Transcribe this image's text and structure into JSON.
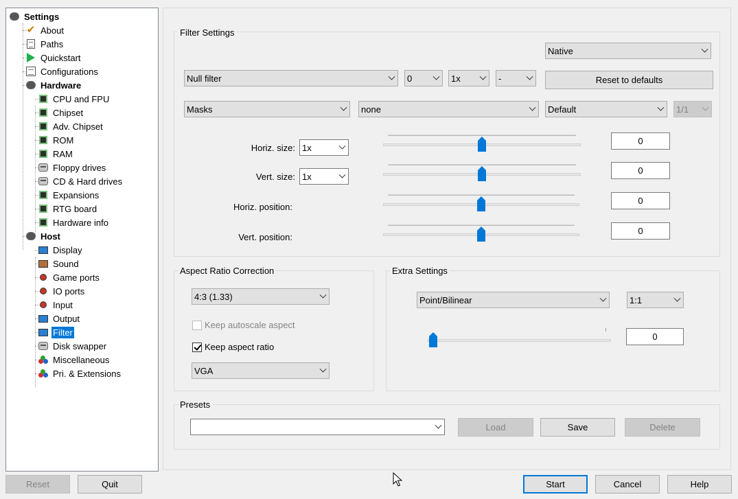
{
  "tree": {
    "items": [
      {
        "label": "Settings",
        "icon": "settings-disk-icon",
        "level": 0,
        "bold": true
      },
      {
        "label": "About",
        "icon": "checkmark-icon",
        "level": 1
      },
      {
        "label": "Paths",
        "icon": "document-icon",
        "level": 1
      },
      {
        "label": "Quickstart",
        "icon": "play-arrow-icon",
        "level": 1
      },
      {
        "label": "Configurations",
        "icon": "configurations-icon",
        "level": 1
      },
      {
        "label": "Hardware",
        "icon": "hardware-disk-icon",
        "level": 1,
        "bold": true
      },
      {
        "label": "CPU and FPU",
        "icon": "chip-icon",
        "level": 2
      },
      {
        "label": "Chipset",
        "icon": "chip-icon",
        "level": 2
      },
      {
        "label": "Adv. Chipset",
        "icon": "chip-icon",
        "level": 2
      },
      {
        "label": "ROM",
        "icon": "rom-chip-icon",
        "level": 2
      },
      {
        "label": "RAM",
        "icon": "ram-chip-icon",
        "level": 2
      },
      {
        "label": "Floppy drives",
        "icon": "floppy-drive-icon",
        "level": 2
      },
      {
        "label": "CD & Hard drives",
        "icon": "cd-drive-icon",
        "level": 2
      },
      {
        "label": "Expansions",
        "icon": "expansion-card-icon",
        "level": 2
      },
      {
        "label": "RTG board",
        "icon": "rtg-board-icon",
        "level": 2
      },
      {
        "label": "Hardware info",
        "icon": "hardware-info-icon",
        "level": 2
      },
      {
        "label": "Host",
        "icon": "host-disk-icon",
        "level": 1,
        "bold": true
      },
      {
        "label": "Display",
        "icon": "monitor-icon",
        "level": 2
      },
      {
        "label": "Sound",
        "icon": "speaker-icon",
        "level": 2
      },
      {
        "label": "Game ports",
        "icon": "joystick-icon",
        "level": 2
      },
      {
        "label": "IO ports",
        "icon": "io-port-icon",
        "level": 2
      },
      {
        "label": "Input",
        "icon": "joystick-icon",
        "level": 2
      },
      {
        "label": "Output",
        "icon": "output-icon",
        "level": 2
      },
      {
        "label": "Filter",
        "icon": "monitor-icon",
        "level": 2,
        "selected": true
      },
      {
        "label": "Disk swapper",
        "icon": "disk-swapper-icon",
        "level": 2
      },
      {
        "label": "Miscellaneous",
        "icon": "misc-icon",
        "level": 2
      },
      {
        "label": "Pri. & Extensions",
        "icon": "extensions-icon",
        "level": 2
      }
    ]
  },
  "filter_settings": {
    "title": "Filter Settings",
    "mode": "Native",
    "filter": "Null filter",
    "filter_value": "0",
    "multiplier": "1x",
    "dash_option": "-",
    "reset_label": "Reset to defaults",
    "masks": "Masks",
    "mask_value": "none",
    "mask_preset": "Default",
    "ratio": "1/1",
    "rows": [
      {
        "label": "Horiz. size:",
        "combo": "1x",
        "value": "0",
        "slider": 0.5
      },
      {
        "label": "Vert. size:",
        "combo": "1x",
        "value": "0",
        "slider": 0.5
      },
      {
        "label": "Horiz. position:",
        "value": "0",
        "slider": 0.5
      },
      {
        "label": "Vert. position:",
        "value": "0",
        "slider": 0.5
      }
    ]
  },
  "aspect": {
    "title": "Aspect Ratio Correction",
    "ratio": "4:3 (1.33)",
    "autoscale_label": "Keep autoscale aspect",
    "keep_label": "Keep aspect ratio",
    "mode": "VGA"
  },
  "extra": {
    "title": "Extra Settings",
    "scaling": "Point/Bilinear",
    "ratio": "1:1",
    "value": "0",
    "slider": 0.0
  },
  "presets": {
    "title": "Presets",
    "selected": "",
    "load_label": "Load",
    "save_label": "Save",
    "delete_label": "Delete"
  },
  "bottom": {
    "reset_label": "Reset",
    "quit_label": "Quit",
    "start_label": "Start",
    "cancel_label": "Cancel",
    "help_label": "Help"
  },
  "colors": {
    "selection": "#0078d7",
    "accent": "#0078d7"
  }
}
